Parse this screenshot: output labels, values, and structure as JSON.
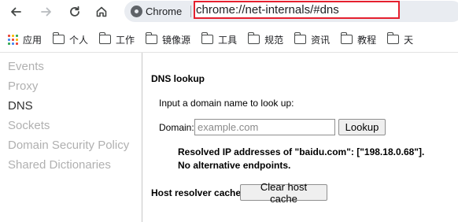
{
  "toolbar": {
    "back_icon": "back-arrow-icon",
    "forward_icon": "forward-arrow-icon",
    "reload_icon": "reload-icon",
    "home_icon": "home-icon",
    "site_chip_label": "Chrome",
    "url": "chrome://net-internals/#dns",
    "url_highlight_color": "#e5202e"
  },
  "bookmarks": [
    {
      "label": "应用",
      "icon": "apps-grid-icon"
    },
    {
      "label": "个人",
      "icon": "folder-icon"
    },
    {
      "label": "工作",
      "icon": "folder-icon"
    },
    {
      "label": "镜像源",
      "icon": "folder-icon"
    },
    {
      "label": "工具",
      "icon": "folder-icon"
    },
    {
      "label": "规范",
      "icon": "folder-icon"
    },
    {
      "label": "资讯",
      "icon": "folder-icon"
    },
    {
      "label": "教程",
      "icon": "folder-icon"
    },
    {
      "label": "天",
      "icon": "folder-icon"
    }
  ],
  "sidebar": {
    "items": [
      {
        "label": "Events",
        "active": false
      },
      {
        "label": "Proxy",
        "active": false
      },
      {
        "label": "DNS",
        "active": true
      },
      {
        "label": "Sockets",
        "active": false
      },
      {
        "label": "Domain Security Policy",
        "active": false
      },
      {
        "label": "Shared Dictionaries",
        "active": false
      }
    ]
  },
  "dns": {
    "title": "DNS lookup",
    "prompt": "Input a domain name to look up:",
    "domain_label": "Domain:",
    "domain_placeholder": "example.com",
    "domain_value": "",
    "lookup_label": "Lookup",
    "result_line1": "Resolved IP addresses of \"baidu.com\": [\"198.18.0.68\"].",
    "result_line2": "No alternative endpoints.",
    "cache_label": "Host resolver cache",
    "clear_cache_label": "Clear host cache"
  }
}
